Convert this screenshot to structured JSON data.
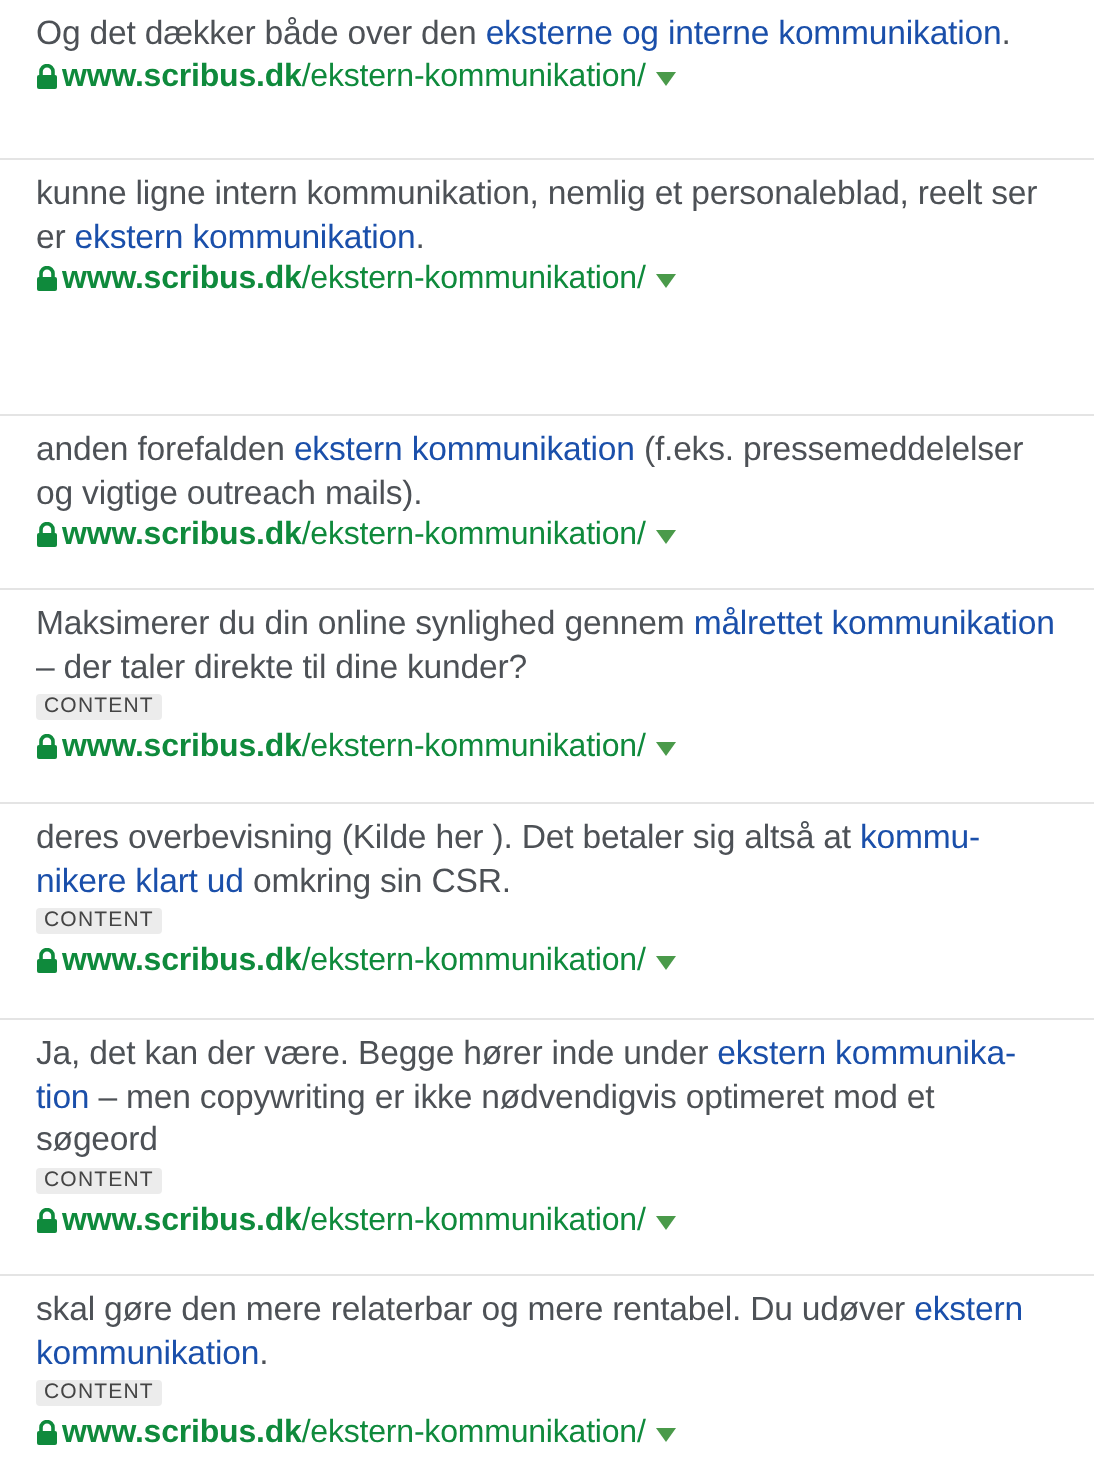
{
  "results": [
    {
      "lines": [
        [
          {
            "text": "Og det dækker både over den ",
            "link": false
          },
          {
            "text": "eksterne og interne kommunikation",
            "link": true
          },
          {
            "text": ".",
            "link": false
          }
        ]
      ],
      "url": {
        "domain": "www.scribus.dk",
        "path": "/ekstern-kommunikation/"
      }
    },
    {
      "lines": [
        [
          {
            "text": "kunne ligne intern kommunikation, nemlig et personaleblad, reelt ser",
            "link": false
          }
        ],
        [
          {
            "text": "er ",
            "link": false
          },
          {
            "text": "ekstern kommunikation",
            "link": true
          },
          {
            "text": ".",
            "link": false
          }
        ]
      ],
      "url": {
        "domain": "www.scribus.dk",
        "path": "/ekstern-kommunikation/"
      }
    },
    {
      "lines": [
        [
          {
            "text": "anden forefalden ",
            "link": false
          },
          {
            "text": "ekstern kommunikation",
            "link": true
          },
          {
            "text": " (f.eks. pressemeddelelser",
            "link": false
          }
        ],
        [
          {
            "text": "og vigtige outreach mails).",
            "link": false
          }
        ]
      ],
      "url": {
        "domain": "www.scribus.dk",
        "path": "/ekstern-kommunikation/"
      }
    },
    {
      "lines": [
        [
          {
            "text": "Maksimerer du din online synlighed gennem ",
            "link": false
          },
          {
            "text": "målrettet kommunikation",
            "link": true
          }
        ],
        [
          {
            "text": "– der taler direkte til dine kunder?",
            "link": false
          }
        ]
      ],
      "tag": "CONTENT",
      "url": {
        "domain": "www.scribus.dk",
        "path": "/ekstern-kommunikation/"
      }
    },
    {
      "lines": [
        [
          {
            "text": "deres overbevisning (Kilde her ). Det betaler sig altså at ",
            "link": false
          },
          {
            "text": "kommu-",
            "link": true
          }
        ],
        [
          {
            "text": "nikere klart ud",
            "link": true
          },
          {
            "text": " omkring sin CSR.",
            "link": false
          }
        ]
      ],
      "tag": "CONTENT",
      "url": {
        "domain": "www.scribus.dk",
        "path": "/ekstern-kommunikation/"
      }
    },
    {
      "lines": [
        [
          {
            "text": "Ja, det kan der være. Begge hører inde under ",
            "link": false
          },
          {
            "text": "ekstern kommunika-",
            "link": true
          }
        ],
        [
          {
            "text": "tion",
            "link": true
          },
          {
            "text": " – men copywriting er ikke nødvendigvis optimeret mod et",
            "link": false
          }
        ],
        [
          {
            "text": "søgeord",
            "link": false
          }
        ]
      ],
      "tag": "CONTENT",
      "url": {
        "domain": "www.scribus.dk",
        "path": "/ekstern-kommunikation/"
      }
    },
    {
      "lines": [
        [
          {
            "text": "skal gøre den mere relaterbar og mere rentabel. Du udøver ",
            "link": false
          },
          {
            "text": "ekstern",
            "link": true
          }
        ],
        [
          {
            "text": "kommunikation",
            "link": true
          },
          {
            "text": ".",
            "link": false
          }
        ]
      ],
      "tag": "CONTENT",
      "url": {
        "domain": "www.scribus.dk",
        "path": "/ekstern-kommunikation/"
      }
    }
  ]
}
